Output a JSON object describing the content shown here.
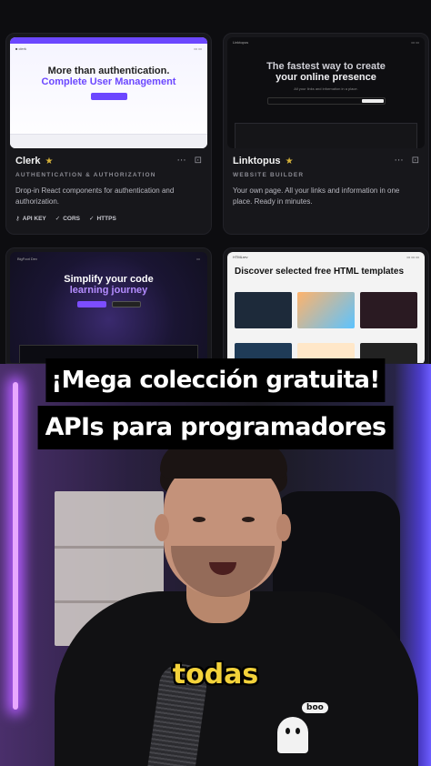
{
  "cards": [
    {
      "name": "Clerk",
      "category": "AUTHENTICATION & AUTHORIZATION",
      "description": "Drop-in React components for authentication and authorization.",
      "tags": [
        "API KEY",
        "CORS",
        "HTTPS"
      ],
      "thumb": {
        "headline_1": "More than authentication.",
        "headline_2": "Complete User Management"
      }
    },
    {
      "name": "Linktopus",
      "category": "WEBSITE BUILDER",
      "description": "Your own page. All your links and information in one place. Ready in minutes.",
      "thumb": {
        "headline_1": "The fastest way to create",
        "headline_2": "your online presence",
        "sub": "All your links and information in a place.",
        "logo": "Linktopus"
      }
    },
    {
      "thumb": {
        "headline_1": "Simplify your code",
        "headline_2": "learning journey",
        "logo": "BigFoot Dev"
      }
    },
    {
      "thumb": {
        "headline_1": "Discover selected free HTML templates",
        "logo": "HTMLrev"
      }
    }
  ],
  "icons": {
    "star": "★",
    "more": "⋯",
    "bookmark": "⊡",
    "key": "⚷",
    "check": "✓"
  },
  "colors": {
    "star": "#d6b23a",
    "clerk_accent": "#6c47ff",
    "subtitle": "#f3d23a"
  },
  "captions": {
    "line_1": "¡Mega colección gratuita!",
    "line_2": "APIs para programadores"
  },
  "subtitle_word": "todas",
  "sticker_text": "boo"
}
